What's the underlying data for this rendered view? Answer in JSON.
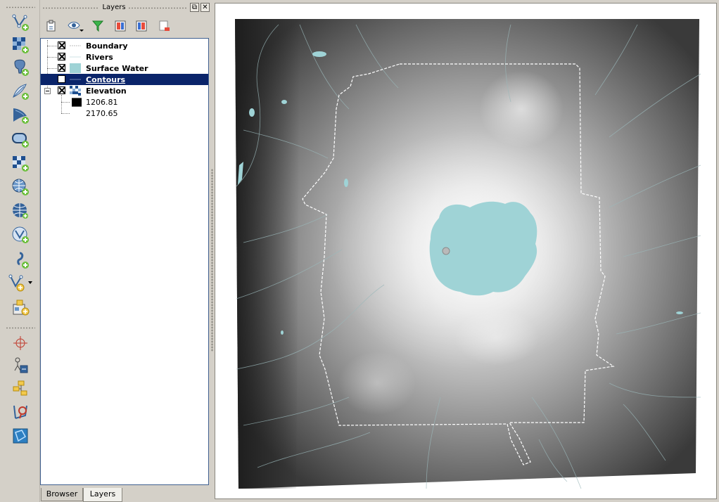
{
  "dock": {
    "title": "Layers",
    "float_button": "⧉",
    "close_button": "✕"
  },
  "layers": [
    {
      "name": "Boundary",
      "checked": true,
      "symbol": "line"
    },
    {
      "name": "Rivers",
      "checked": true,
      "symbol": "thin-line"
    },
    {
      "name": "Surface Water",
      "checked": true,
      "symbol": "fill",
      "color": "#9fd3d6"
    },
    {
      "name": "Contours",
      "checked": false,
      "symbol": "line",
      "selected": true
    },
    {
      "name": "Elevation",
      "checked": true,
      "symbol": "raster",
      "expanded": true
    }
  ],
  "elevation_legend": {
    "min": "1206.81",
    "max": "2170.65"
  },
  "tabs": {
    "browser": "Browser",
    "layers": "Layers",
    "active": "layers"
  },
  "colors": {
    "selection": "#0a246a",
    "water": "#9fd3d6",
    "boundary": "#ffffff"
  },
  "toolbar_icons": [
    "add-vector-layer-icon",
    "add-raster-layer-icon",
    "add-postgis-layer-icon",
    "add-spatialite-layer-icon",
    "add-mssql-layer-icon",
    "add-oracle-layer-icon",
    "add-wms-layer-icon",
    "add-wcs-layer-icon",
    "add-wfs-layer-icon",
    "add-delimited-text-layer-icon",
    "new-vector-layer-icon",
    "new-spatialite-layer-icon",
    "gps-tools-icon",
    "georeferencer-icon",
    "coordinate-capture-icon",
    "topology-checker-icon",
    "map-overview-icon"
  ]
}
